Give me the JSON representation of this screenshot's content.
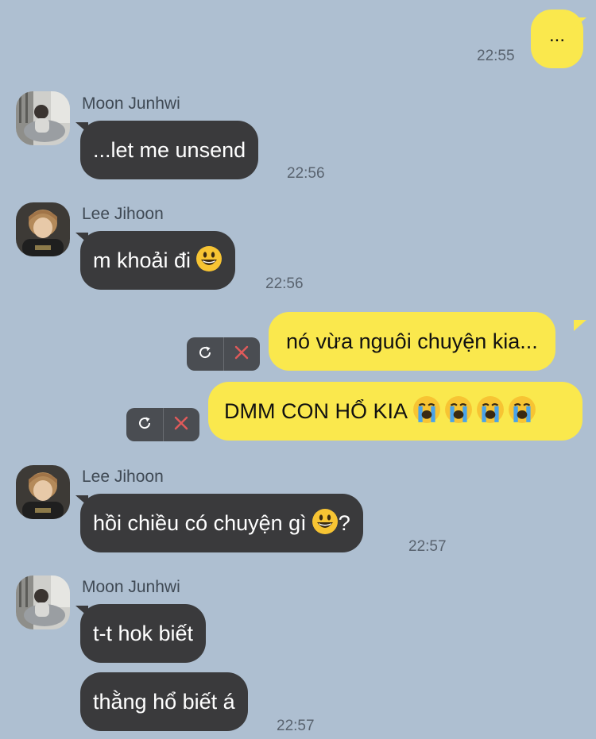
{
  "colors": {
    "background": "#aebfd1",
    "incoming_bubble": "#3a3a3c",
    "outgoing_bubble": "#fae84d",
    "retry_box": "#4a4d52",
    "delete_x": "#e05a5a"
  },
  "messages": {
    "m1": {
      "text": "...",
      "time": "22:55"
    },
    "m2": {
      "sender": "Moon Junhwi",
      "text": "...let me unsend",
      "time": "22:56"
    },
    "m3": {
      "sender": "Lee Jihoon",
      "text": "m khoải đi",
      "emoji": "grinning-face",
      "time": "22:56"
    },
    "m4": {
      "text": "nó vừa nguôi chuyện kia..."
    },
    "m5": {
      "text": "DMM CON HỔ KIA",
      "emoji": "loudly-crying-face ×4"
    },
    "m6": {
      "sender": "Lee Jihoon",
      "text_before": "hồi chiều có chuyện gì",
      "emoji": "grinning-face",
      "text_after": "?",
      "time": "22:57"
    },
    "m7": {
      "sender": "Moon Junhwi",
      "text": "t-t hok biết"
    },
    "m8": {
      "text": "thằng hổ biết á",
      "time": "22:57"
    }
  },
  "icons": {
    "retry": "refresh-icon",
    "delete": "close-icon",
    "avatar_moon": "avatar-moon-junhwi",
    "avatar_lee": "avatar-lee-jihoon"
  }
}
